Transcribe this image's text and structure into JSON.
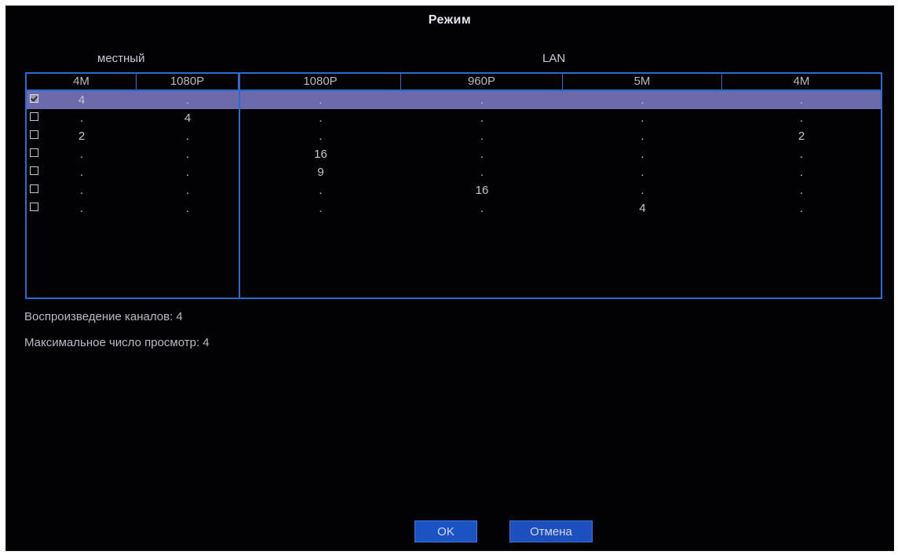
{
  "dialog": {
    "title": "Режим"
  },
  "groups": {
    "local": "местный",
    "lan": "LAN"
  },
  "columns": [
    "4M",
    "1080P",
    "1080P",
    "960P",
    "5M",
    "4M"
  ],
  "rows": [
    {
      "checked": true,
      "values": [
        "4",
        ".",
        ".",
        ".",
        ".",
        "."
      ]
    },
    {
      "checked": false,
      "values": [
        ".",
        "4",
        ".",
        ".",
        ".",
        "."
      ]
    },
    {
      "checked": false,
      "values": [
        "2",
        ".",
        ".",
        ".",
        ".",
        "2"
      ]
    },
    {
      "checked": false,
      "values": [
        ".",
        ".",
        "16",
        ".",
        ".",
        "."
      ]
    },
    {
      "checked": false,
      "values": [
        ".",
        ".",
        "9",
        ".",
        ".",
        "."
      ]
    },
    {
      "checked": false,
      "values": [
        ".",
        ".",
        ".",
        "16",
        ".",
        "."
      ]
    },
    {
      "checked": false,
      "values": [
        ".",
        ".",
        ".",
        ".",
        "4",
        "."
      ]
    }
  ],
  "info": {
    "playback_channels": "Воспроизведение каналов: 4",
    "max_view": "Максимальное число просмотр: 4"
  },
  "buttons": {
    "ok": "OK",
    "cancel": "Отмена"
  }
}
